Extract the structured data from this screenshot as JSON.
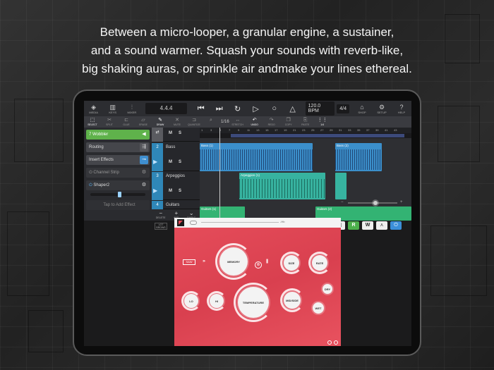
{
  "headline": {
    "line1": "Between a micro-looper,  a granular engine, a sustainer,",
    "line2": "and a sound warmer. Squash your sounds with reverb-like,",
    "line3": "big shaking auras, or sprinkle air andmake your lines ethereal."
  },
  "toolbar": {
    "media": "MEDIA",
    "keys": "KEYS",
    "mixer": "MIXER",
    "position": "4.4.4",
    "bpm": "120.0 BPM",
    "signature": "4/4",
    "shop": "SHOP",
    "setup": "SETUP",
    "help": "HELP"
  },
  "tools": {
    "select": "SELECT",
    "split": "SPLIT",
    "glue": "GLUE",
    "erase": "ERASE",
    "draw": "DRAW",
    "mute": "MUTE",
    "quantize": "QUANTIZE",
    "zoom_value": "1/16",
    "stretch": "STRETCH",
    "undo": "UNDO",
    "redo": "REDO",
    "copy": "COPY",
    "paste": "PASTE",
    "grid_value": "1/4"
  },
  "leftpanel": {
    "track_name": "7  Wobbler",
    "routing": "Routing",
    "insert_effects": "Insert Effects",
    "channel_strip": "Channel Strip",
    "shaper": "Shaper2",
    "add_effect": "Tap to Add Effect"
  },
  "tracks": [
    {
      "num": "",
      "name": "",
      "m": "M",
      "s": "S"
    },
    {
      "num": "2",
      "name": "Bass",
      "m": "M",
      "s": "S"
    },
    {
      "num": "3",
      "name": "Arpeggios",
      "m": "M",
      "s": "S"
    },
    {
      "num": "4",
      "name": "Guitars",
      "m": "M",
      "s": "S"
    }
  ],
  "ruler": [
    "1",
    "3",
    "5",
    "7",
    "9",
    "11",
    "13",
    "15",
    "17",
    "19",
    "21",
    "23",
    "25",
    "27",
    "29",
    "31",
    "33",
    "35",
    "37",
    "39",
    "41",
    "43"
  ],
  "clips": {
    "bass1": "Bass (1)",
    "bass2": "Bass (2)",
    "arp1": "Arpeggios (1)",
    "gtr1": "Guitars (1)",
    "gtr2": "Guitars (2)"
  },
  "edit": {
    "delete": "DELETE",
    "add": "ADD",
    "duplicate": "DUPLC"
  },
  "lower": {
    "lot_brows": "LOT BROWS"
  },
  "plugin": {
    "top_value": "-Hb",
    "saw": "SAW",
    "memory": "MEMORY",
    "size": "SIZE",
    "rate": "RATE",
    "lo": "LO",
    "hi": "HI",
    "temperature": "TEMPERATURE",
    "mid_side": "MID/SIDE",
    "dry": "DRY",
    "wet": "WET"
  }
}
